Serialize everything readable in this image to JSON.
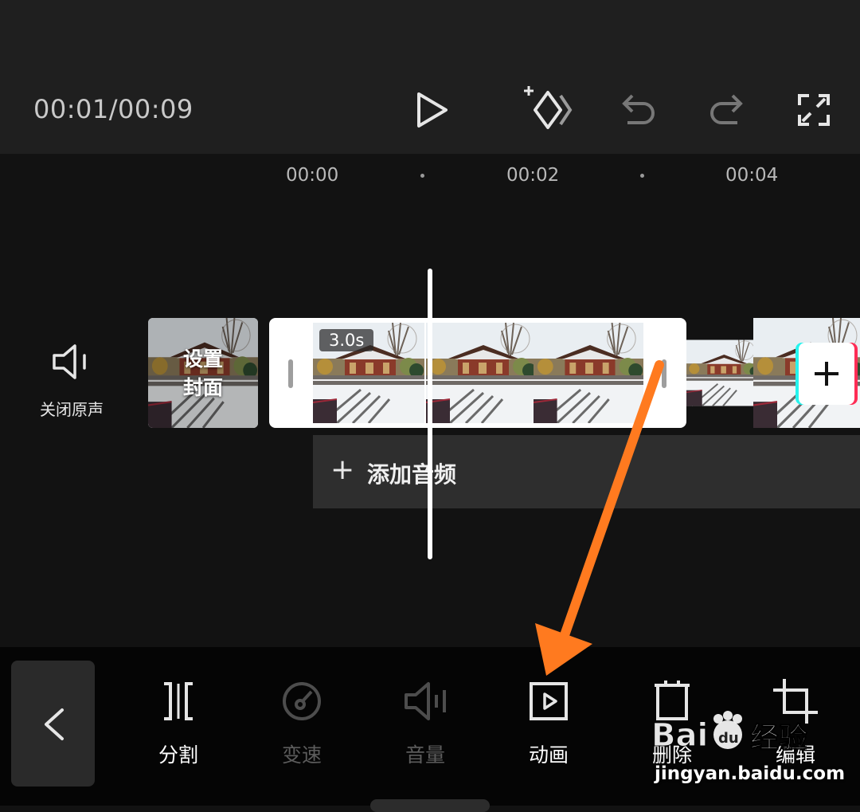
{
  "toolbar": {
    "time_display": "00:01/00:09"
  },
  "ruler": {
    "labels": [
      "00:00",
      "00:02",
      "00:04"
    ]
  },
  "audio": {
    "mute_label": "关闭原声"
  },
  "cover": {
    "label_line1": "设置",
    "label_line2": "封面"
  },
  "clip": {
    "duration": "3.0s"
  },
  "audio_track": {
    "add_label": "添加音频"
  },
  "tools": [
    {
      "label": "分割",
      "icon": "split-icon",
      "enabled": true
    },
    {
      "label": "变速",
      "icon": "speed-icon",
      "enabled": false
    },
    {
      "label": "音量",
      "icon": "volume-icon",
      "enabled": false
    },
    {
      "label": "动画",
      "icon": "animation-icon",
      "enabled": true
    },
    {
      "label": "删除",
      "icon": "delete-icon",
      "enabled": true
    },
    {
      "label": "编辑",
      "icon": "crop-icon",
      "enabled": true
    }
  ],
  "watermark": {
    "brand": "Baidu经验",
    "url": "jingyan.baidu.com"
  },
  "colors": {
    "accent_arrow": "#ff7a1f",
    "tiktok_cyan": "#25f4ee",
    "tiktok_red": "#fe2c55"
  }
}
